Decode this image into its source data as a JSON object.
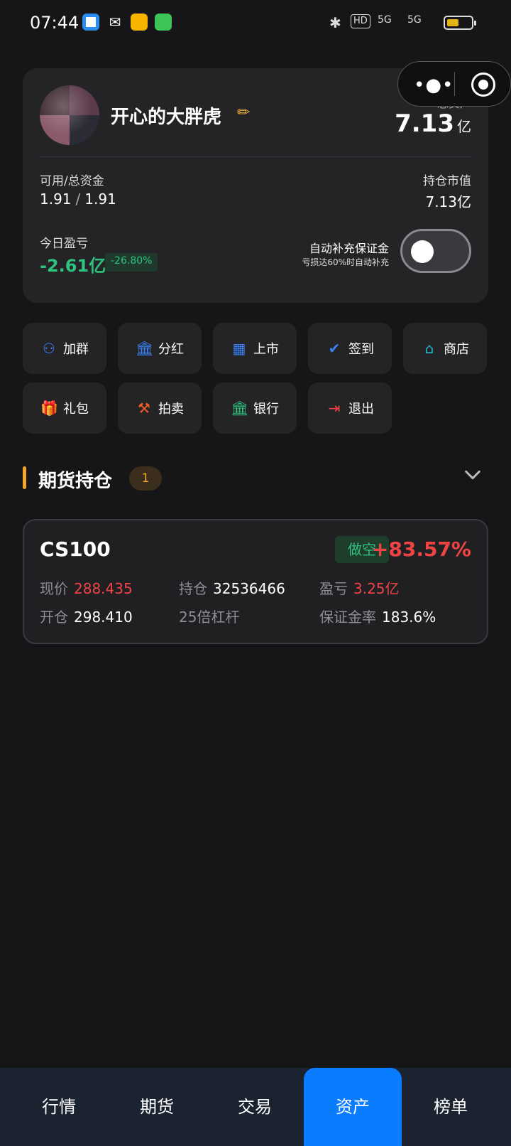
{
  "status_bar": {
    "time": "07:44",
    "indicators": [
      "bluetooth-icon",
      "HD",
      "5G",
      "5G"
    ]
  },
  "profile": {
    "nickname": "开心的大胖虎",
    "edit_icon": "pencil-icon",
    "total_assets_label": "总资产",
    "total_assets_value": "7.13",
    "total_assets_unit": "亿",
    "available_label": "可用/总资金",
    "available_value": "1.91",
    "total_funds_value": "1.91",
    "slash": "/",
    "market_value_label": "持仓市值",
    "market_value": "7.13亿",
    "daily_pnl_label": "今日盈亏",
    "daily_pnl_value": "-2.61亿",
    "daily_pnl_pct": "-26.80%",
    "auto_margin_label": "自动补充保证金",
    "auto_margin_sub": "亏损达60%时自动补充",
    "auto_margin_enabled": false
  },
  "actions": [
    {
      "label": "加群",
      "icon": "group-icon"
    },
    {
      "label": "分红",
      "icon": "bank-icon"
    },
    {
      "label": "上市",
      "icon": "building-icon"
    },
    {
      "label": "签到",
      "icon": "check-circle-icon"
    },
    {
      "label": "商店",
      "icon": "store-icon"
    },
    {
      "label": "礼包",
      "icon": "gift-icon"
    },
    {
      "label": "拍卖",
      "icon": "gavel-icon"
    },
    {
      "label": "银行",
      "icon": "bank-icon"
    },
    {
      "label": "退出",
      "icon": "logout-icon"
    }
  ],
  "section": {
    "title": "期货持仓",
    "count": "1"
  },
  "position": {
    "symbol": "CS100",
    "side": "做空",
    "pnl_pct": "+83.57%",
    "price_label": "现价",
    "price_value": "288.435",
    "holding_label": "持仓",
    "holding_value": "32536466",
    "pnl_label": "盈亏",
    "pnl_value": "3.25亿",
    "open_label": "开仓",
    "open_value": "298.410",
    "leverage": "25倍杠杆",
    "margin_rate_label": "保证金率",
    "margin_rate_value": "183.6%"
  },
  "bottom_nav": [
    {
      "label": "行情",
      "active": false
    },
    {
      "label": "期货",
      "active": false
    },
    {
      "label": "交易",
      "active": false
    },
    {
      "label": "资产",
      "active": true
    },
    {
      "label": "榜单",
      "active": false
    }
  ],
  "colors": {
    "background": "#161618",
    "card": "#242427",
    "accent_blue": "#0a7cff",
    "profit_green": "#2ec27e",
    "loss_red": "#ef4444",
    "section_accent": "#f5a623"
  }
}
